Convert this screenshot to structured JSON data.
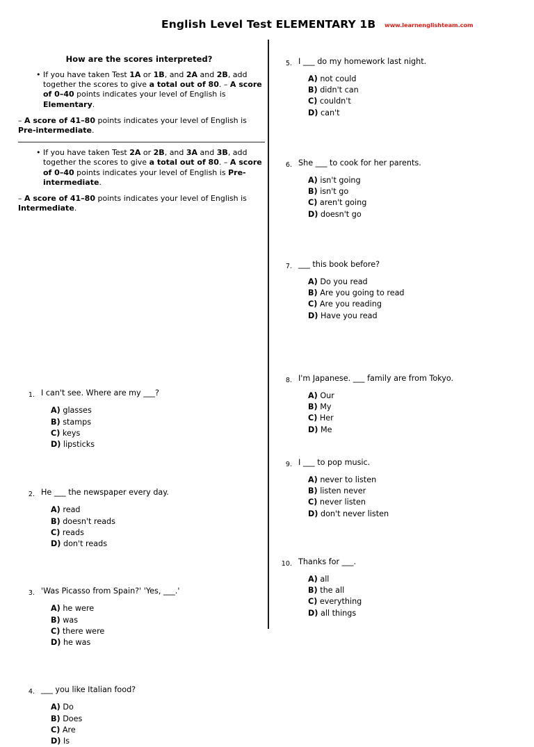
{
  "header": {
    "title": "English Level Test ELEMENTARY 1B",
    "url": "www.learnenglishteam.com",
    "url_color": "#e8201a"
  },
  "scoring": {
    "heading": "How are the scores interpreted?",
    "blocks": [
      {
        "bullet": "If you have taken Test 1A or 1B, and 2A and 2B, add together the scores to give a total out of 80. – A score of 0–40 points indicates your level of English is Elementary.",
        "tail": "– A score of 41–80 points indicates your level of English is Pre-intermediate."
      },
      {
        "bullet": "If you have taken Test 2A or 2B, and 3A and 3B, add together the scores to give a total out of 80. – A score of 0–40 points indicates your level of English is Pre-intermediate.",
        "tail": "– A score of 41–80 points indicates your level of English is Intermediate."
      }
    ]
  },
  "questions": {
    "left": [
      {
        "number": "1.",
        "text": "I can't see. Where are my ___?",
        "options": [
          {
            "letter": "A)",
            "text": "glasses"
          },
          {
            "letter": "B)",
            "text": "stamps"
          },
          {
            "letter": "C)",
            "text": "keys"
          },
          {
            "letter": "D)",
            "text": "lipsticks"
          }
        ]
      },
      {
        "number": "2.",
        "text": "He ___ the newspaper every day.",
        "options": [
          {
            "letter": "A)",
            "text": "read"
          },
          {
            "letter": "B)",
            "text": "doesn't reads"
          },
          {
            "letter": "C)",
            "text": "reads"
          },
          {
            "letter": "D)",
            "text": "don't reads"
          }
        ]
      },
      {
        "number": "3.",
        "text": "'Was Picasso from Spain?' 'Yes, ___.'",
        "options": [
          {
            "letter": "A)",
            "text": "he were"
          },
          {
            "letter": "B)",
            "text": "was"
          },
          {
            "letter": "C)",
            "text": "there were"
          },
          {
            "letter": "D)",
            "text": "he was"
          }
        ]
      },
      {
        "number": "4.",
        "text": "___ you like Italian food?",
        "options": [
          {
            "letter": "A)",
            "text": "Do"
          },
          {
            "letter": "B)",
            "text": "Does"
          },
          {
            "letter": "C)",
            "text": "Are"
          },
          {
            "letter": "D)",
            "text": "Is"
          }
        ]
      }
    ],
    "right": [
      {
        "number": "5.",
        "text": "I ___ do my homework last night.",
        "options": [
          {
            "letter": "A)",
            "text": "not could"
          },
          {
            "letter": "B)",
            "text": "didn't can"
          },
          {
            "letter": "C)",
            "text": "couldn't"
          },
          {
            "letter": "D)",
            "text": "can't"
          }
        ]
      },
      {
        "number": "6.",
        "text": "She ___ to cook for her parents.",
        "options": [
          {
            "letter": "A)",
            "text": "isn't going"
          },
          {
            "letter": "B)",
            "text": "isn't go"
          },
          {
            "letter": "C)",
            "text": "aren't going"
          },
          {
            "letter": "D)",
            "text": "doesn't go"
          }
        ]
      },
      {
        "number": "7.",
        "text": "___ this book before?",
        "options": [
          {
            "letter": "A)",
            "text": "Do you read"
          },
          {
            "letter": "B)",
            "text": "Are you going to read"
          },
          {
            "letter": "C)",
            "text": "Are you reading"
          },
          {
            "letter": "D)",
            "text": "Have you read"
          }
        ]
      },
      {
        "number": "8.",
        "text": "I'm Japanese. ___ family are from Tokyo.",
        "options": [
          {
            "letter": "A)",
            "text": "Our"
          },
          {
            "letter": "B)",
            "text": "My"
          },
          {
            "letter": "C)",
            "text": "Her"
          },
          {
            "letter": "D)",
            "text": "Me"
          }
        ]
      },
      {
        "number": "9.",
        "text": "I ___ to pop music.",
        "options": [
          {
            "letter": "A)",
            "text": "never to listen"
          },
          {
            "letter": "B)",
            "text": "listen never"
          },
          {
            "letter": "C)",
            "text": "never listen"
          },
          {
            "letter": "D)",
            "text": "don't never listen"
          }
        ]
      },
      {
        "number": "10.",
        "text": "Thanks for ___.",
        "options": [
          {
            "letter": "A)",
            "text": "all"
          },
          {
            "letter": "B)",
            "text": "the all"
          },
          {
            "letter": "C)",
            "text": "everything"
          },
          {
            "letter": "D)",
            "text": "all things"
          }
        ]
      }
    ]
  },
  "layout": {
    "left_question_tops": [
      252,
      395,
      537,
      679
    ],
    "right_question_tops": [
      0,
      146,
      292,
      456,
      577,
      720
    ]
  }
}
